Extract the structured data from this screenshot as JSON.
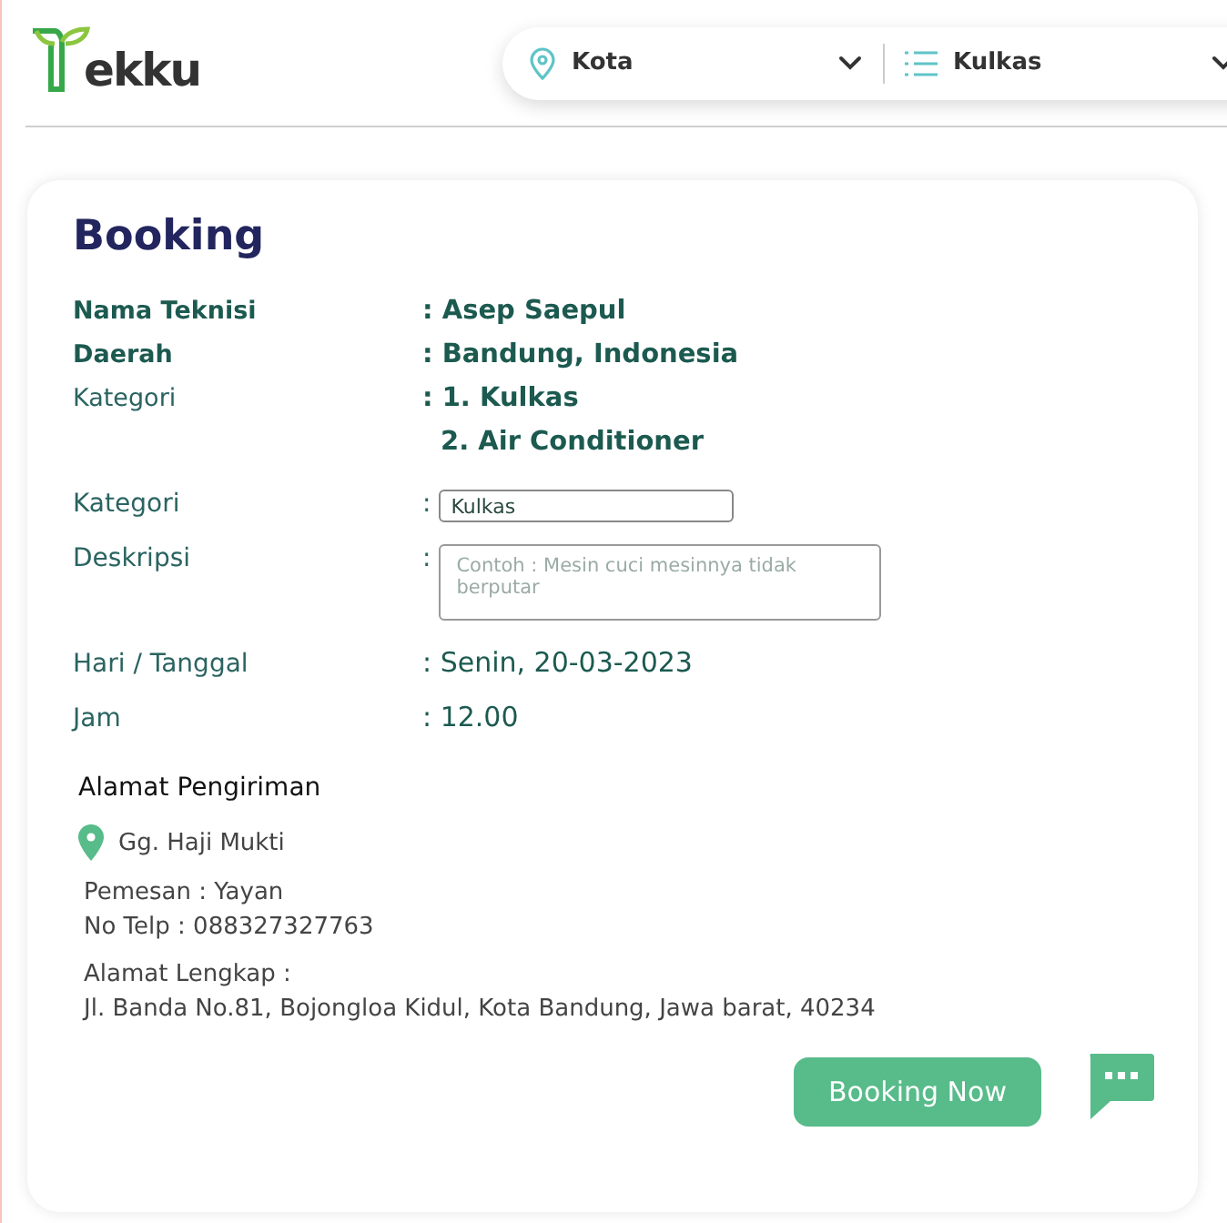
{
  "header": {
    "logo": "ekku",
    "location_select": {
      "value": "Kota"
    },
    "category_select": {
      "value": "Kulkas"
    }
  },
  "booking": {
    "title": "Booking",
    "details": [
      {
        "label": "Nama Teknisi",
        "lines": [
          ": Asep Saepul"
        ],
        "emphasis": true
      },
      {
        "label": "Daerah",
        "lines": [
          ": Bandung, Indonesia"
        ],
        "emphasis": true
      },
      {
        "label": "Kategori",
        "lines": [
          ": 1. Kulkas",
          "2. Air Conditioner"
        ],
        "emphasis": false
      }
    ],
    "fields": [
      {
        "label": "Kategori",
        "separator": ":",
        "kind": "input",
        "value": "Kulkas"
      },
      {
        "label": "Deskripsi",
        "separator": ":",
        "kind": "textarea",
        "placeholder": "Contoh : Mesin cuci mesinnya tidak berputar"
      }
    ],
    "schedule": [
      {
        "label": "Hari / Tanggal",
        "value": ": Senin, 20-03-2023"
      },
      {
        "label": "Jam",
        "value": ": 12.00"
      }
    ],
    "address": {
      "title": "Alamat Pengiriman",
      "place": "Gg. Haji Mukti",
      "orderer": "Pemesan : Yayan",
      "phone": "No Telp : 088327327763",
      "full_label": "Alamat Lengkap :",
      "full": "Jl. Banda No.81, Bojongloa Kidul, Kota Bandung, Jawa barat, 40234"
    },
    "book_button": "Booking Now"
  }
}
